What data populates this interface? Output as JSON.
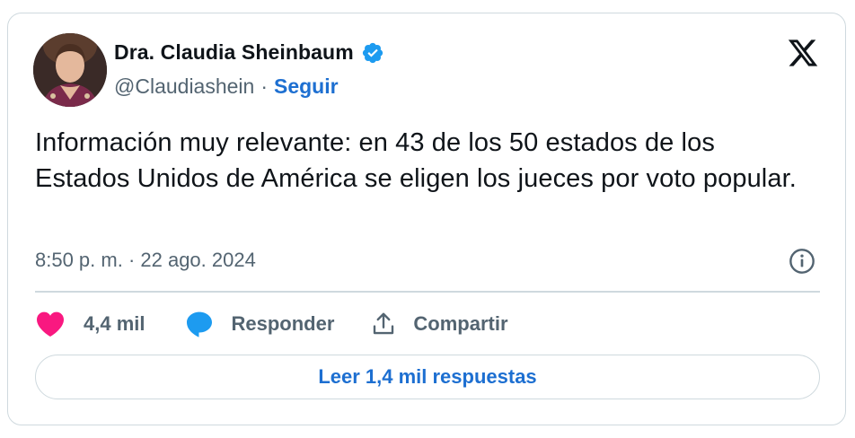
{
  "author": {
    "name": "Dra. Claudia Sheinbaum",
    "handle": "@Claudiashein",
    "separator": "·",
    "follow_label": "Seguir",
    "verified": true
  },
  "tweet": {
    "text": "Información muy relevante: en 43 de los 50 estados de los Estados Unidos de América se eligen los jueces por voto popular.",
    "timestamp": "8:50 p. m. · 22 ago. 2024"
  },
  "actions": {
    "likes_count": "4,4 mil",
    "reply_label": "Responder",
    "share_label": "Compartir"
  },
  "footer": {
    "read_replies_label": "Leer 1,4 mil respuestas"
  },
  "colors": {
    "accent_blue": "#1d6fd1",
    "like_pink": "#f91880",
    "reply_blue": "#1d9bf0",
    "secondary_text": "#536471",
    "border": "#cfd9de"
  },
  "icons": {
    "platform": "x-logo-icon",
    "verified": "verified-badge-icon",
    "info": "info-icon",
    "like": "heart-icon",
    "reply": "speech-bubble-icon",
    "share": "share-upload-icon"
  }
}
